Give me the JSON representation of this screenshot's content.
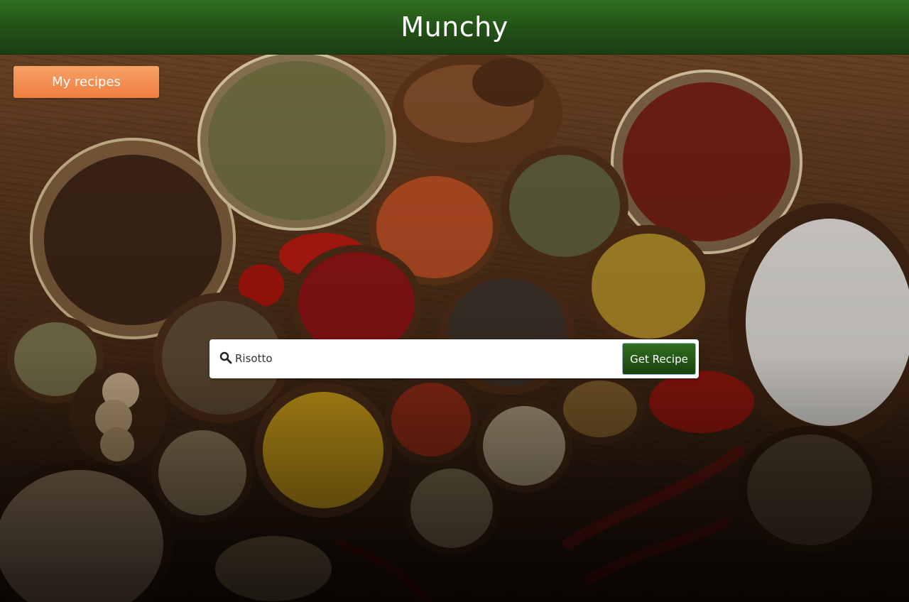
{
  "header": {
    "title": "Munchy"
  },
  "nav": {
    "my_recipes_label": "My recipes"
  },
  "search": {
    "value": "Risotto",
    "placeholder": "",
    "submit_label": "Get Recipe",
    "icon": "search-icon"
  },
  "colors": {
    "header_green": "#225016",
    "button_orange": "#ef7f40",
    "submit_green": "#1b4310"
  }
}
